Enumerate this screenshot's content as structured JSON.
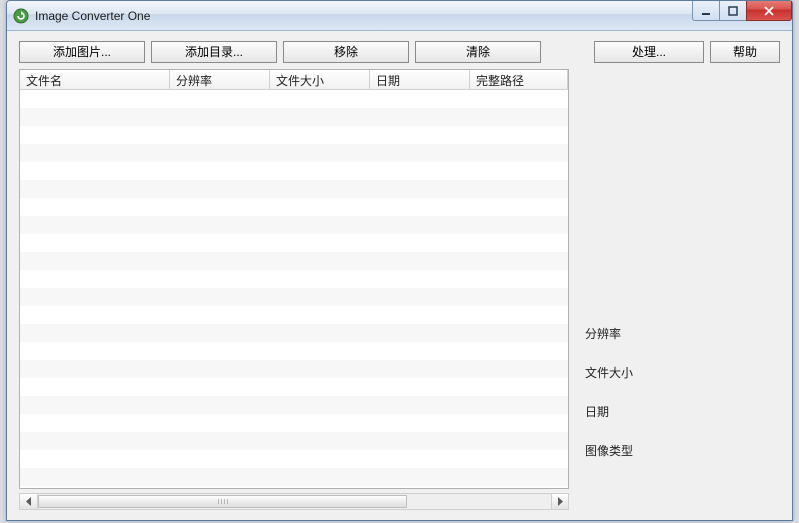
{
  "window": {
    "title": "Image Converter One"
  },
  "toolbar": {
    "add_image": "添加图片...",
    "add_dir": "添加目录...",
    "remove": "移除",
    "clear": "清除",
    "process": "处理...",
    "help": "帮助"
  },
  "columns": {
    "filename": "文件名",
    "resolution": "分辨率",
    "filesize": "文件大小",
    "date": "日期",
    "fullpath": "完整路径"
  },
  "rows": [],
  "info": {
    "resolution_label": "分辨率",
    "filesize_label": "文件大小",
    "date_label": "日期",
    "imagetype_label": "图像类型"
  }
}
